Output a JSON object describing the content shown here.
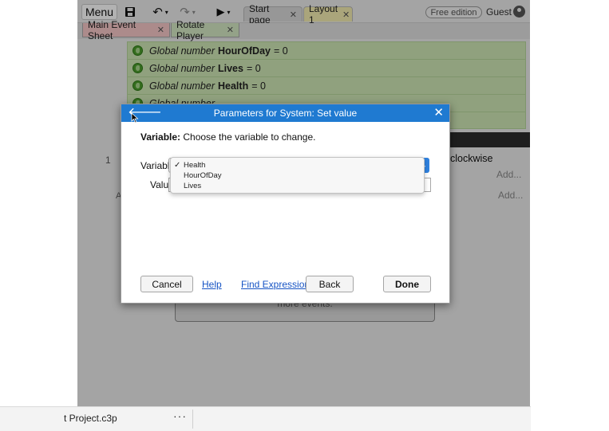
{
  "toolbar": {
    "menu_label": "Menu",
    "save_icon": "save-icon",
    "undo_icon": "undo-icon",
    "redo_icon": "redo-icon",
    "play_icon": "play-icon",
    "undo_glyph": "↶",
    "redo_glyph": "↷",
    "play_glyph": "▶",
    "caret": "▾",
    "tabs": [
      {
        "label": "Start page",
        "close": "✕"
      },
      {
        "label": "Layout 1",
        "close": "✕"
      }
    ],
    "free_edition_label": "Free edition",
    "guest_label": "Guest"
  },
  "sheet_tabs": [
    {
      "label": "Main Event Sheet",
      "close": "✕",
      "color": "#f6c8c8"
    },
    {
      "label": "Rotate Player",
      "close": "✕",
      "color": "#d4e8c3"
    }
  ],
  "events": {
    "global_vars": [
      {
        "prefix": "Global number",
        "name": "HourOfDay",
        "value": "= 0"
      },
      {
        "prefix": "Global number",
        "name": "Lives",
        "value": "= 0"
      },
      {
        "prefix": "Global number",
        "name": "Health",
        "value": "= 0"
      },
      {
        "prefix": "Global number",
        "name": "",
        "value": ""
      },
      {
        "prefix": "",
        "name": "",
        "value": ""
      }
    ],
    "row_number": "1",
    "row_number_alt": "A",
    "clockwise_text": "clockwise",
    "add_link_1": "Add...",
    "add_link_2": "Add...",
    "more_events_text": "more events."
  },
  "statusbar": {
    "project_name": "t Project.c3p",
    "more_label": "···"
  },
  "dialog": {
    "title": "Parameters for System: Set value",
    "back_arrow_glyph": "🡐",
    "close_glyph": "✕",
    "heading_bold": "Variable:",
    "heading_text": " Choose the variable to change.",
    "variable_label": "Variable",
    "value_label": "Value",
    "select_arrow": "⌄",
    "dropdown_options": [
      {
        "label": "Health",
        "checked": true
      },
      {
        "label": "HourOfDay",
        "checked": false
      },
      {
        "label": "Lives",
        "checked": false
      }
    ],
    "check_glyph": "✓",
    "buttons": {
      "cancel": "Cancel",
      "help": "Help",
      "find_expressions": "Find Expressions",
      "back": "Back",
      "done": "Done"
    }
  },
  "colors": {
    "titlebar": "#1f7ad1",
    "var_row": "#cfe7b5",
    "link": "#1553c4"
  }
}
